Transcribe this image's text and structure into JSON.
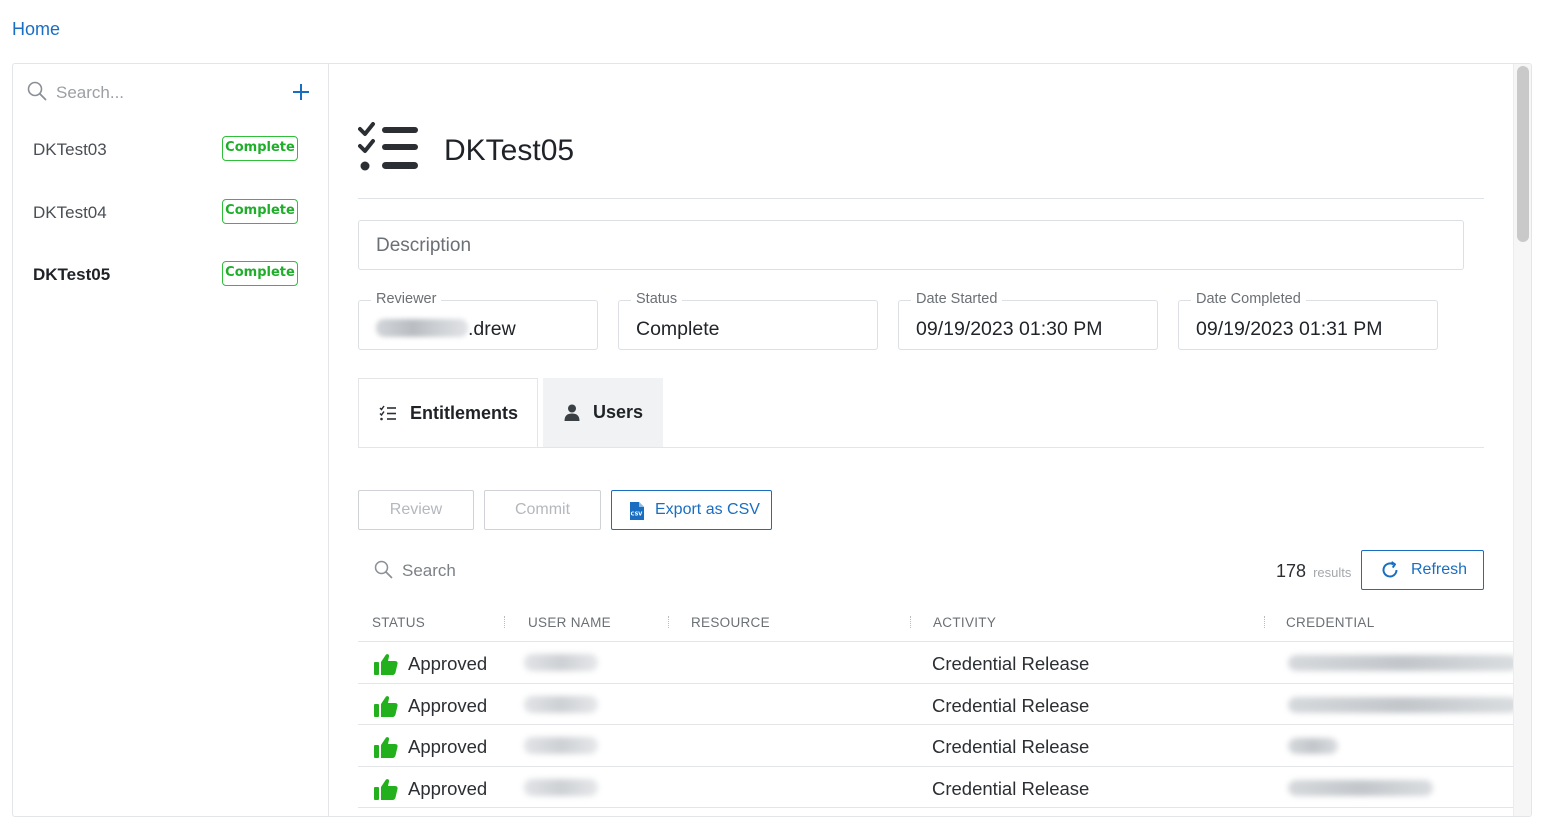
{
  "breadcrumb": {
    "home": "Home"
  },
  "sidebar": {
    "search_placeholder": "Search...",
    "items": [
      {
        "name": "DKTest03",
        "status": "Complete"
      },
      {
        "name": "DKTest04",
        "status": "Complete"
      },
      {
        "name": "DKTest05",
        "status": "Complete"
      }
    ],
    "selected": "DKTest05"
  },
  "detail": {
    "title": "DKTest05",
    "description_placeholder": "Description",
    "fields": {
      "reviewer": {
        "label": "Reviewer",
        "value_visible": ".drew"
      },
      "status": {
        "label": "Status",
        "value": "Complete"
      },
      "date_started": {
        "label": "Date Started",
        "value": "09/19/2023 01:30 PM"
      },
      "date_completed": {
        "label": "Date Completed",
        "value": "09/19/2023 01:31 PM"
      }
    }
  },
  "tabs": [
    {
      "label": "Entitlements",
      "active": true,
      "icon": "checklist-icon"
    },
    {
      "label": "Users",
      "active": false,
      "icon": "user-icon"
    }
  ],
  "actions": {
    "review": "Review",
    "commit": "Commit",
    "export": "Export as CSV"
  },
  "grid": {
    "search_placeholder": "Search",
    "results_count": "178",
    "results_label": "results",
    "refresh": "Refresh",
    "columns": [
      "STATUS",
      "USER NAME",
      "RESOURCE",
      "ACTIVITY",
      "CREDENTIAL"
    ],
    "rows": [
      {
        "status": "Approved",
        "activity": "Credential Release"
      },
      {
        "status": "Approved",
        "activity": "Credential Release"
      },
      {
        "status": "Approved",
        "activity": "Credential Release"
      },
      {
        "status": "Approved",
        "activity": "Credential Release"
      }
    ]
  },
  "colors": {
    "accent": "#1a6ec2",
    "complete_badge": "#2fbf3a",
    "approved_icon": "#22b11c"
  }
}
